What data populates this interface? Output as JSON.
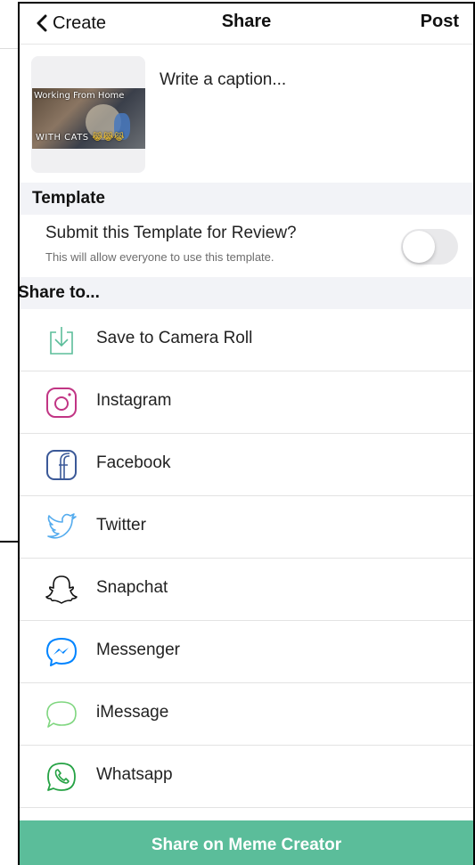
{
  "nav": {
    "back_label": "Create",
    "title": "Share",
    "post_label": "Post"
  },
  "caption": {
    "placeholder": "Write a caption...",
    "thumbnail_top_text": "Working From Home",
    "thumbnail_bottom_text": "WITH CATS",
    "thumbnail_emojis": "😹😹😹"
  },
  "template_section": {
    "heading": "Template",
    "review_title": "Submit this Template for Review?",
    "review_subtitle": "This will allow everyone to use this template.",
    "toggle_on": false
  },
  "share_section": {
    "heading": "Share to...",
    "items": [
      {
        "label": "Save to Camera Roll",
        "icon": "download-icon"
      },
      {
        "label": "Instagram",
        "icon": "instagram-icon"
      },
      {
        "label": "Facebook",
        "icon": "facebook-icon"
      },
      {
        "label": "Twitter",
        "icon": "twitter-icon"
      },
      {
        "label": "Snapchat",
        "icon": "snapchat-icon"
      },
      {
        "label": "Messenger",
        "icon": "messenger-icon"
      },
      {
        "label": "iMessage",
        "icon": "imessage-icon"
      },
      {
        "label": "Whatsapp",
        "icon": "whatsapp-icon"
      }
    ]
  },
  "bottom_button": {
    "label": "Share on Meme Creator"
  },
  "colors": {
    "accent": "#5bbd9a",
    "section_bg": "#f2f3f7",
    "toggle_off": "#e9e9eb"
  }
}
